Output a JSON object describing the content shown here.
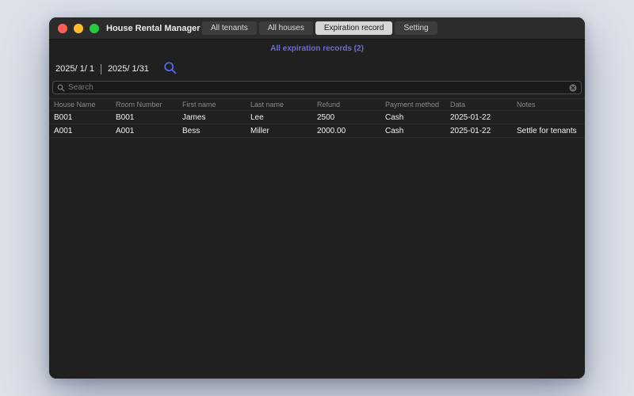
{
  "colors": {
    "desktop_background": "#dde1ea",
    "window_background": "#202020",
    "link_accent": "#6b6bdd",
    "date_search_icon_blue": "#4d6bf5",
    "traffic_red": "#ff5f57",
    "traffic_yellow": "#febc2e",
    "traffic_green": "#28c840",
    "active_tab_background": "#d6d6d6"
  },
  "window": {
    "title": "House Rental Manager",
    "tabs": [
      {
        "label": "All tenants",
        "active": false
      },
      {
        "label": "All houses",
        "active": false
      },
      {
        "label": "Expiration record",
        "active": true
      },
      {
        "label": "Setting",
        "active": false
      }
    ]
  },
  "subheader": {
    "link": "All expiration records (2)"
  },
  "filters": {
    "date_from": "2025/ 1/ 1",
    "date_to": "2025/ 1/31"
  },
  "search": {
    "placeholder": "Search",
    "value": ""
  },
  "table": {
    "columns": [
      "House Name",
      "Room Number",
      "First name",
      "Last name",
      "Refund",
      "Payment method",
      "Data",
      "Notes"
    ],
    "rows": [
      [
        "B001",
        "B001",
        "James",
        "Lee",
        "2500",
        "Cash",
        "2025-01-22",
        ""
      ],
      [
        "A001",
        "A001",
        "Bess",
        "Miller",
        "2000.00",
        "Cash",
        "2025-01-22",
        "Settle for tenants"
      ]
    ]
  }
}
